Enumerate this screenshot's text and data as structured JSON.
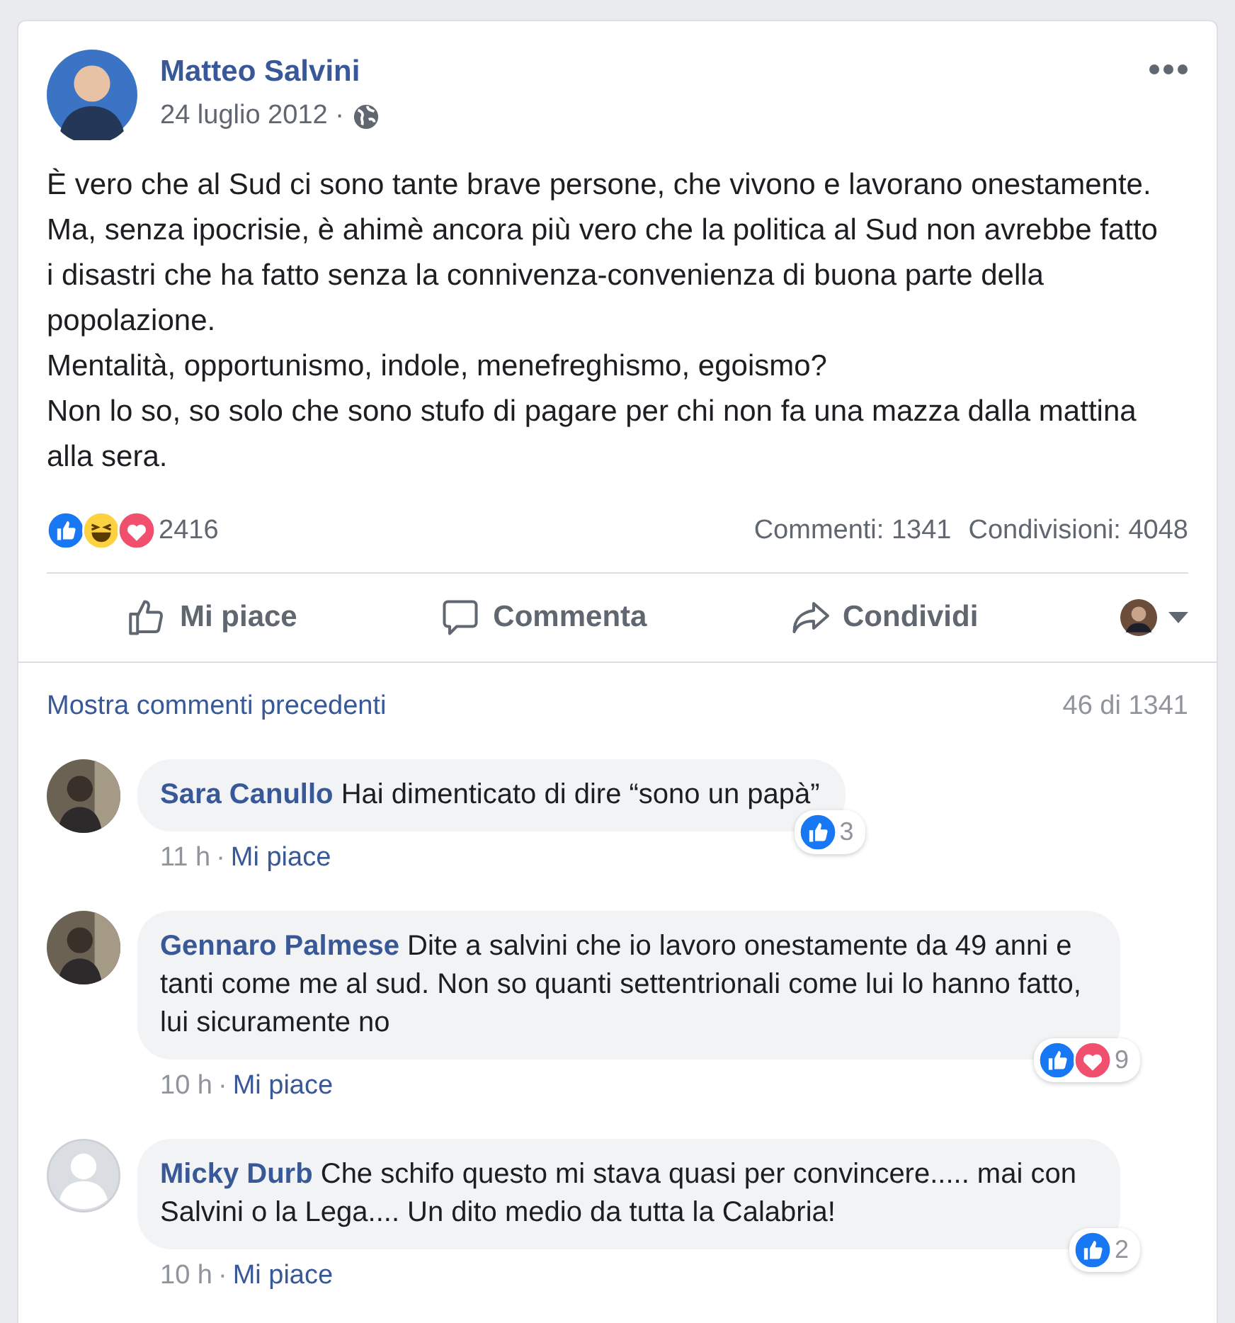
{
  "post": {
    "author": "Matteo Salvini",
    "date": "24 luglio 2012 ·",
    "paragraphs": [
      "È vero che al Sud ci sono tante brave persone, che vivono e lavorano onestamente. Ma, senza ipocrisie, è ahimè ancora più vero che la politica al Sud non avrebbe fatto i disastri che ha fatto senza la connivenza-convenienza di buona parte della popolazione.",
      "Mentalità, opportunismo, indole, menefreghismo, egoismo?",
      "Non lo so, so solo che sono stufo di pagare per chi non fa una mazza dalla mattina alla sera."
    ],
    "reactions": [
      {
        "kind": "like"
      },
      {
        "kind": "haha"
      },
      {
        "kind": "love"
      }
    ],
    "reaction_count": "2416",
    "comments_count": "Commenti: 1341",
    "shares_count": "Condivisioni: 4048"
  },
  "actions": [
    {
      "kind": "like",
      "label": "Mi piace"
    },
    {
      "kind": "comment",
      "label": "Commenta"
    },
    {
      "kind": "share",
      "label": "Condividi"
    }
  ],
  "comments_header": {
    "link": "Mostra commenti precedenti",
    "count": "46 di 1341"
  },
  "comments": [
    {
      "author": "Sara Canullo",
      "text": "Hai dimenticato di dire “sono un papà”",
      "time": "11 h",
      "like": "Mi piace",
      "reactions": [
        {
          "kind": "like"
        }
      ],
      "reaction_count": "3",
      "sep": "·",
      "kind": "photo"
    },
    {
      "author": "Gennaro Palmese",
      "text": "Dite a salvini che io lavoro onestamente da 49 anni e tanti come me al sud. Non so quanti settentrionali come lui lo hanno fatto, lui sicuramente no",
      "time": "10 h",
      "like": "Mi piace",
      "reactions": [
        {
          "kind": "like"
        },
        {
          "kind": "love"
        }
      ],
      "reaction_count": "9",
      "sep": "·",
      "kind": "photo"
    },
    {
      "author": "Micky Durb",
      "text": "Che schifo questo mi stava quasi per convincere..... mai con Salvini o la Lega.... Un dito medio da tutta la Calabria!",
      "time": "10 h",
      "like": "Mi piace",
      "reactions": [
        {
          "kind": "like"
        }
      ],
      "reaction_count": "2",
      "sep": "·",
      "kind": "default"
    }
  ]
}
